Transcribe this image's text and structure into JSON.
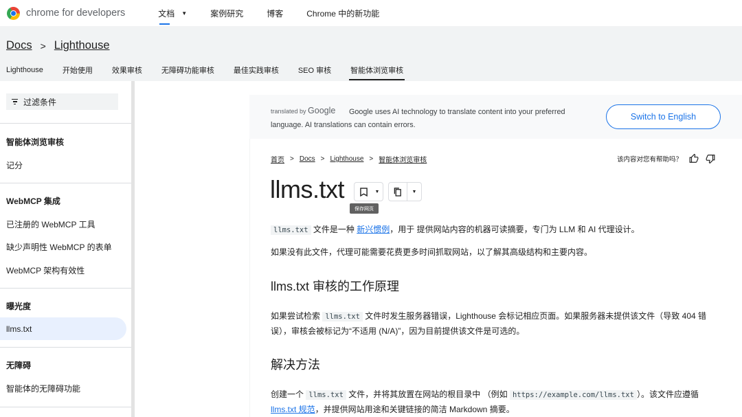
{
  "header": {
    "logo_text": "chrome for developers",
    "nav": [
      {
        "label": "文档",
        "active": true
      },
      {
        "label": "案例研究"
      },
      {
        "label": "博客"
      },
      {
        "label": "Chrome 中的新功能"
      }
    ]
  },
  "top_breadcrumb": [
    "Docs",
    "Lighthouse"
  ],
  "subnav": [
    "Lighthouse",
    "开始使用",
    "效果审核",
    "无障碍功能审核",
    "最佳实践审核",
    "SEO 审核",
    "智能体浏览审核"
  ],
  "sidebar": {
    "filter_label": "过滤条件",
    "sections": [
      {
        "title": "智能体浏览审核",
        "items": [
          "记分"
        ]
      },
      {
        "title": "WebMCP 集成",
        "items": [
          "已注册的 WebMCP 工具",
          "缺少声明性 WebMCP 的表单",
          "WebMCP 架构有效性"
        ]
      },
      {
        "title": "曝光度",
        "items": [
          "llms.txt"
        ],
        "selected": "llms.txt"
      },
      {
        "title": "无障碍",
        "items": [
          "智能体的无障碍功能"
        ]
      }
    ]
  },
  "translate_banner": {
    "translated_by": "translated by",
    "google": "Google",
    "message": "Google uses AI technology to translate content into your preferred language. AI translations can contain errors.",
    "button": "Switch to English"
  },
  "article_breadcrumb": [
    "首页",
    "Docs",
    "Lighthouse",
    "智能体浏览审核"
  ],
  "helpful_prompt": "该内容对您有帮助吗？",
  "title": "llms.txt",
  "tooltip": "保存网页",
  "content": {
    "p1": {
      "code": "llms.txt",
      "a": " 文件是一种 ",
      "link": "新兴惯例",
      "b": "，用于 提供网站内容的机器可读摘要，专门为 LLM 和 AI 代理设计。"
    },
    "p2": "如果没有此文件，代理可能需要花费更多时间抓取网站，以了解其高级结构和主要内容。",
    "h2_1": "llms.txt 审核的工作原理",
    "p3": {
      "a": "如果尝试检索 ",
      "code": "llms.txt",
      "b": " 文件时发生服务器错误，Lighthouse 会标记相应页面。如果服务器未提供该文件（导致 404 错误），审核会被标记为“不适用 (N/A)”，因为目前提供该文件是可选的。"
    },
    "h2_2": "解决方法",
    "p4": {
      "a": "创建一个 ",
      "code1": "llms.txt",
      "b": " 文件，并将其放置在网站的根目录中 （例如 ",
      "code2": "https://example.com/llms.txt",
      "c": "）。该文件应遵循 ",
      "link": "llms.txt 规范",
      "d": "，并提供网站用途和关键链接的简洁 Markdown 摘要。"
    }
  },
  "colors": {
    "accent": "#1a73e8",
    "header_bg": "#f1f3f4",
    "selected_bg": "#e8f0fe"
  }
}
